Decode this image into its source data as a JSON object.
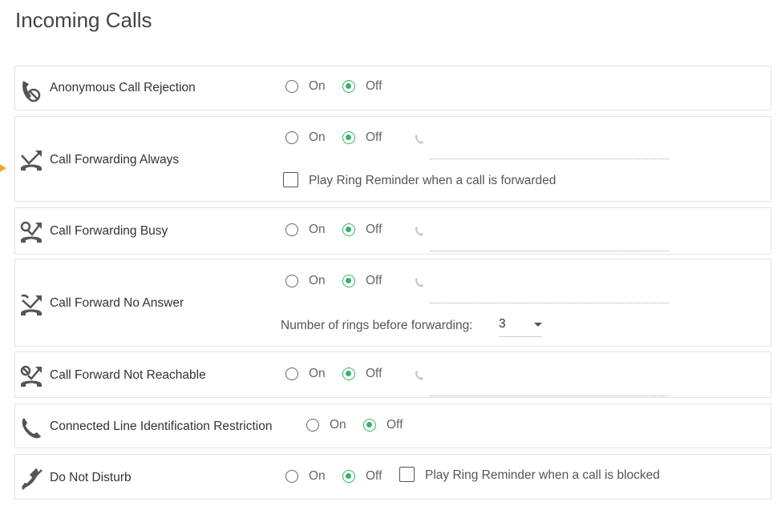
{
  "page": {
    "title": "Incoming Calls"
  },
  "options": {
    "on": "On",
    "off": "Off"
  },
  "rows": [
    {
      "label": "Anonymous Call Rejection",
      "icon": "anonymous-rejection-icon",
      "selected": "off"
    },
    {
      "label": "Call Forwarding Always",
      "icon": "call-forward-icon",
      "selected": "off",
      "number": "",
      "reminder": "Play Ring Reminder when a call is forwarded",
      "reminder_checked": false
    },
    {
      "label": "Call Forwarding Busy",
      "icon": "call-forward-busy-icon",
      "selected": "off",
      "number": ""
    },
    {
      "label": "Call Forward No Answer",
      "icon": "call-forward-no-answer-icon",
      "selected": "off",
      "number": "",
      "rings_label": "Number of rings before forwarding:",
      "rings_value": "3"
    },
    {
      "label": "Call Forward Not Reachable",
      "icon": "call-forward-not-reachable-icon",
      "selected": "off",
      "number": ""
    },
    {
      "label": "Connected Line Identification Restriction",
      "icon": "phone-icon",
      "selected": "off"
    },
    {
      "label": "Do Not Disturb",
      "icon": "do-not-disturb-icon",
      "selected": "off",
      "reminder": "Play Ring Reminder when a call is blocked",
      "reminder_checked": false
    }
  ],
  "colors": {
    "accent": "#36b36b",
    "indicator": "#f5a623"
  }
}
